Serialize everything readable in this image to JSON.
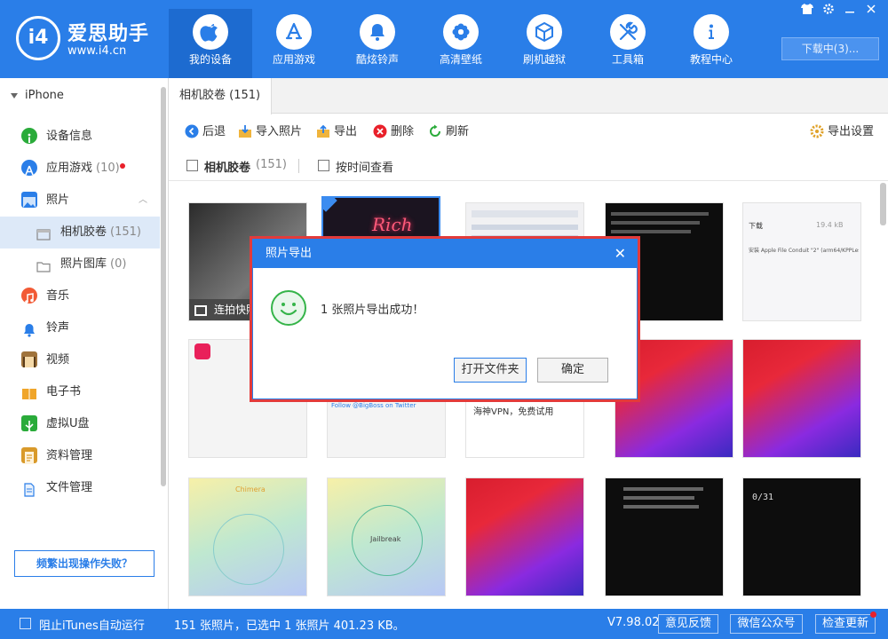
{
  "app": {
    "logo_mark": "i4",
    "name": "爱思助手",
    "url": "www.i4.cn"
  },
  "nav": [
    {
      "label": "我的设备",
      "icon": "apple-icon"
    },
    {
      "label": "应用游戏",
      "icon": "appstore-icon"
    },
    {
      "label": "酷炫铃声",
      "icon": "bell-icon"
    },
    {
      "label": "高清壁纸",
      "icon": "flower-icon"
    },
    {
      "label": "刷机越狱",
      "icon": "box-icon"
    },
    {
      "label": "工具箱",
      "icon": "tools-icon"
    },
    {
      "label": "教程中心",
      "icon": "info-icon"
    }
  ],
  "window_controls": [
    "shirt-icon",
    "gear-icon",
    "minimize-icon",
    "close-icon"
  ],
  "download_label": "下载中(3)...",
  "sidebar": {
    "device": "iPhone",
    "items": [
      {
        "label": "设备信息",
        "count": "",
        "icon": "info-circle-icon",
        "color": "#2aab3a"
      },
      {
        "label": "应用游戏",
        "count": "(10)",
        "icon": "appstore-icon",
        "color": "#2a7ee8",
        "dot": true
      },
      {
        "label": "照片",
        "count": "",
        "icon": "photo-icon",
        "color": "#2a7ee8",
        "expanded": true
      },
      {
        "label": "相机胶卷",
        "count": "(151)",
        "icon": "folder-icon",
        "sub": true,
        "active": true
      },
      {
        "label": "照片图库",
        "count": "(0)",
        "icon": "folder-icon",
        "sub": true
      },
      {
        "label": "音乐",
        "count": "",
        "icon": "music-icon",
        "color": "#f25a35"
      },
      {
        "label": "铃声",
        "count": "",
        "icon": "bell-icon",
        "color": "#2a7ee8"
      },
      {
        "label": "视频",
        "count": "",
        "icon": "film-icon",
        "color": "#a0733b"
      },
      {
        "label": "电子书",
        "count": "",
        "icon": "book-icon",
        "color": "#f0a52a"
      },
      {
        "label": "虚拟U盘",
        "count": "",
        "icon": "usb-icon",
        "color": "#2aab3a"
      },
      {
        "label": "资料管理",
        "count": "",
        "icon": "doc-icon",
        "color": "#d99a2a"
      },
      {
        "label": "文件管理",
        "count": "",
        "icon": "file-icon",
        "color": "#2a7ee8"
      }
    ],
    "help_button": "频繁出现操作失败？"
  },
  "main": {
    "tab": "相机胶卷 (151)",
    "toolbar": {
      "back": "后退",
      "import": "导入照片",
      "export": "导出",
      "delete": "删除",
      "refresh": "刷新",
      "export_settings": "导出设置"
    },
    "filter": {
      "album": "相机胶卷",
      "album_count": "(151)",
      "by_time": "按时间查看"
    },
    "thumbs": [
      {
        "caption": "连拍快照"
      },
      {
        "caption": "Rich"
      },
      {
        "caption": ""
      },
      {
        "caption": ""
      },
      {
        "caption": "下载",
        "extra": "19.4 kB",
        "extra2": "安装 Apple File Conduit \"2\" (arm64/KPPLess)"
      },
      {
        "caption": ""
      },
      {
        "caption": "Follow @BigBoss on Twitter"
      },
      {
        "caption": "海神VPN，免费试用"
      },
      {
        "caption": ""
      },
      {
        "caption": ""
      },
      {
        "caption": "Chimera"
      },
      {
        "caption": "Jailbreak"
      },
      {
        "caption": ""
      },
      {
        "caption": ""
      },
      {
        "caption": "0/31"
      }
    ]
  },
  "dialog": {
    "title": "照片导出",
    "message": "1 张照片导出成功！",
    "open_folder": "打开文件夹",
    "ok": "确定"
  },
  "status": {
    "block_itunes": "阻止iTunes自动运行",
    "summary": "151 张照片，已选中 1 张照片 401.23 KB。",
    "version": "V7.98.02",
    "feedback": "意见反馈",
    "wechat": "微信公众号",
    "update": "检查更新"
  }
}
